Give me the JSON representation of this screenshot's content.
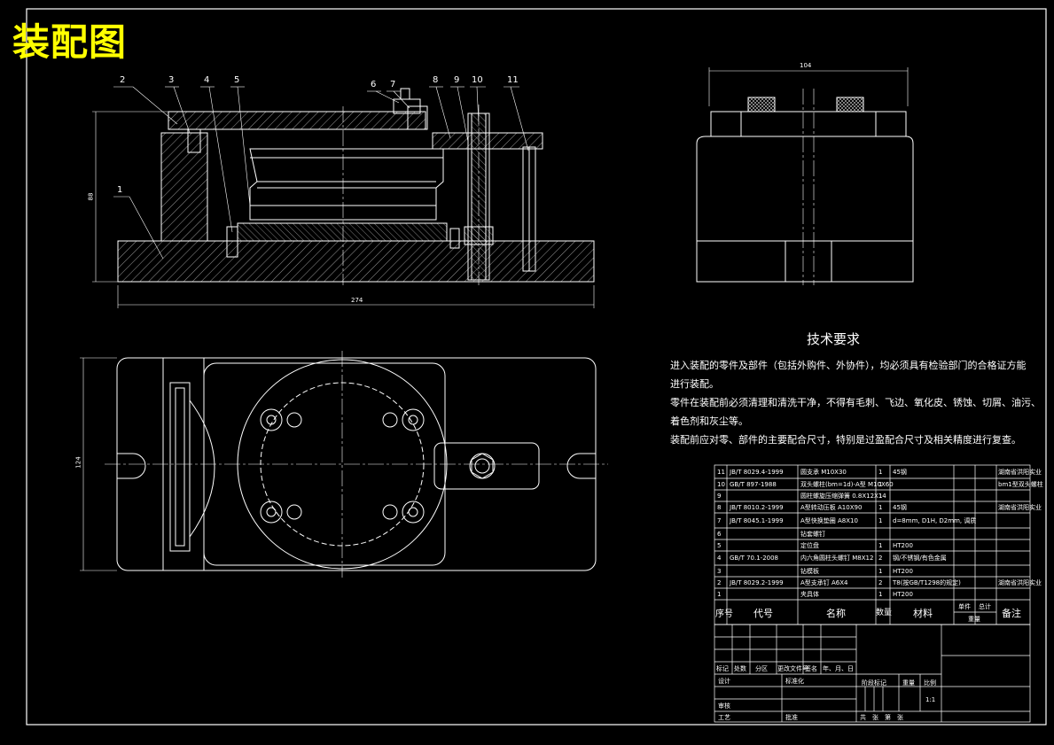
{
  "drawing_title": "装配图",
  "callouts": [
    "1",
    "2",
    "3",
    "4",
    "5",
    "6",
    "7",
    "8",
    "9",
    "10",
    "11"
  ],
  "dimensions": {
    "front_width": "274",
    "front_height": "88",
    "top_height": "124",
    "side_width": "104"
  },
  "tech_requirements": {
    "title": "技术要求",
    "lines": [
      "进入装配的零件及部件（包括外购件、外协件），均必须具有检验部门的合格证方能",
      "进行装配。",
      "零件在装配前必须清理和清洗干净，不得有毛刺、飞边、氧化皮、锈蚀、切屑、油污、",
      "着色剂和灰尘等。",
      "装配前应对零、部件的主要配合尺寸，特别是过盈配合尺寸及相关精度进行复查。"
    ]
  },
  "bom_rows": [
    {
      "no": "11",
      "code": "JB/T 8029.4-1999",
      "name": "圆支承 M10X30",
      "qty": "1",
      "mat": "45钢",
      "note": "湖南省洪阳实业"
    },
    {
      "no": "10",
      "code": "GB/T 897-1988",
      "name": "双头螺柱(bm=1d)-A型 M10X60",
      "qty": "1",
      "mat": "",
      "note": "bm1型双头螺柱"
    },
    {
      "no": "9",
      "code": "",
      "name": "圆柱螺旋压缩弹簧 0.8X12X14",
      "qty": "1",
      "mat": "",
      "note": ""
    },
    {
      "no": "8",
      "code": "JB/T 8010.2-1999",
      "name": "A型转动压板 A10X90",
      "qty": "1",
      "mat": "45钢",
      "note": "湖南省洪阳实业"
    },
    {
      "no": "7",
      "code": "JB/T 8045.1-1999",
      "name": "A型快换垫圈 A8X10",
      "qty": "1",
      "mat": "d=8mm, D1H, D2mm, 调质",
      "note": ""
    },
    {
      "no": "6",
      "code": "",
      "name": "钻套螺钉",
      "qty": "",
      "mat": "",
      "note": ""
    },
    {
      "no": "5",
      "code": "",
      "name": "定位盘",
      "qty": "1",
      "mat": "HT200",
      "note": ""
    },
    {
      "no": "4",
      "code": "GB/T 70.1-2008",
      "name": "内六角圆柱头螺钉 M8X12",
      "qty": "2",
      "mat": "钢/不锈钢/有色金属",
      "note": ""
    },
    {
      "no": "3",
      "code": "",
      "name": "钻模板",
      "qty": "1",
      "mat": "HT200",
      "note": ""
    },
    {
      "no": "2",
      "code": "JB/T 8029.2-1999",
      "name": "A型支承钉 A6X4",
      "qty": "2",
      "mat": "T8(按GB/T1298的规定)",
      "note": "湖南省洪阳实业"
    },
    {
      "no": "1",
      "code": "",
      "name": "夹具体",
      "qty": "1",
      "mat": "HT200",
      "note": ""
    }
  ],
  "bom_header": {
    "no": "序号",
    "code": "代号",
    "name": "名称",
    "qty": "数量",
    "mat": "材料",
    "single": "单件",
    "total": "总计",
    "weight": "重量",
    "note": "备注"
  },
  "title_block": {
    "mark": "标记",
    "places": "处数",
    "zone": "分区",
    "change_doc": "更改文件号",
    "sign": "签名",
    "date": "年、月、日",
    "design": "设计",
    "standard": "标准化",
    "stage": "阶段标记",
    "weight": "重量",
    "scale": "比例",
    "scale_value": "1:1",
    "review": "审核",
    "process": "工艺",
    "approve": "批准",
    "sheets": "共　张　第　张"
  }
}
